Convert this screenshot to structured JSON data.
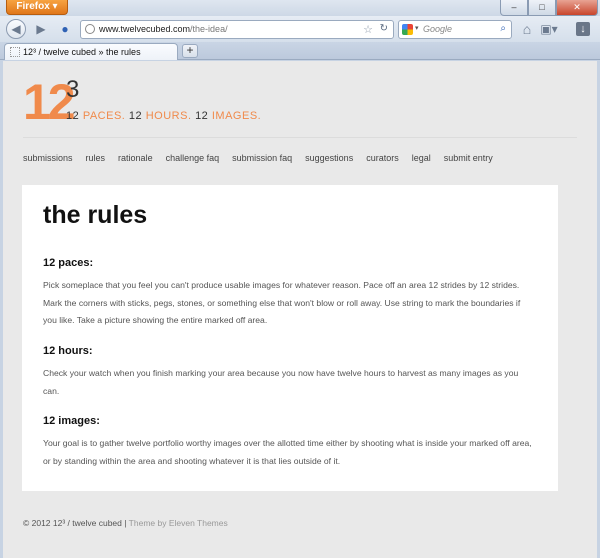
{
  "browser": {
    "app_button": "Firefox",
    "url_domain": "www.twelvecubed.com",
    "url_path": "/the-idea/",
    "search_placeholder": "Google",
    "tab_title": "12³ / twelve cubed » the rules",
    "new_tab_label": "+",
    "window_buttons": [
      "–",
      "□",
      "✕"
    ],
    "icons": [
      "back-icon",
      "forward-icon",
      "site-identity-icon",
      "star-icon",
      "reload-icon",
      "search-engine-icon",
      "magnifier-icon",
      "home-icon",
      "bookmarks-icon",
      "downloads-icon"
    ]
  },
  "site": {
    "logo_main": "12",
    "logo_sup": "3",
    "tagline": [
      {
        "num": "12",
        "word": "PACES."
      },
      {
        "num": "12",
        "word": "HOURS."
      },
      {
        "num": "12",
        "word": "IMAGES."
      }
    ],
    "accent_color": "#f08a4b",
    "nav": [
      "submissions",
      "rules",
      "rationale",
      "challenge faq",
      "submission faq",
      "suggestions",
      "curators",
      "legal",
      "submit entry"
    ]
  },
  "content": {
    "title": "the rules",
    "sections": [
      {
        "heading": "12 paces:",
        "text": "Pick someplace that you feel you can't produce usable images for whatever reason. Pace off an area 12 strides by 12 strides. Mark the corners with sticks, pegs, stones, or something else that won't blow or roll away. Use string to mark the boundaries if you like. Take a picture showing the entire marked off area."
      },
      {
        "heading": "12 hours:",
        "text": "Check your watch when you finish marking your area because you now have twelve hours to harvest as many images as you can."
      },
      {
        "heading": "12 images:",
        "text": "Your goal is to gather twelve portfolio worthy images over the allotted time either by shooting what is inside your marked off area, or by standing within the area and shooting whatever it is that lies outside of it."
      }
    ]
  },
  "footer": {
    "copyright": "© 2012 12³ / twelve cubed |",
    "theme_credit": "Theme by Eleven Themes"
  }
}
